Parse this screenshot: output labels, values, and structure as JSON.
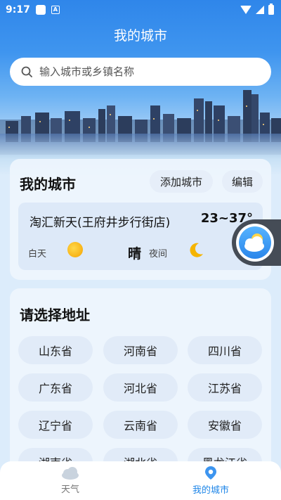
{
  "status": {
    "time": "9:17"
  },
  "header": {
    "title": "我的城市"
  },
  "search": {
    "placeholder": "输入城市或乡镇名称"
  },
  "my_cities": {
    "title": "我的城市",
    "add_label": "添加城市",
    "edit_label": "编辑",
    "city": {
      "name": "淘汇新天(王府井步行街店)",
      "temp": "23~37°",
      "day_label": "白天",
      "condition": "晴",
      "night_label": "夜间"
    }
  },
  "address": {
    "title": "请选择地址",
    "provinces": [
      "山东省",
      "河南省",
      "四川省",
      "广东省",
      "河北省",
      "江苏省",
      "辽宁省",
      "云南省",
      "安徽省",
      "湖南省",
      "湖北省",
      "黑龙江省"
    ]
  },
  "nav": {
    "items": [
      {
        "label": "天气",
        "icon": "cloud-icon",
        "active": false
      },
      {
        "label": "我的城市",
        "icon": "location-pin-icon",
        "active": true
      }
    ]
  },
  "colors": {
    "accent": "#1f86e8",
    "sky": "#2f86ea"
  }
}
